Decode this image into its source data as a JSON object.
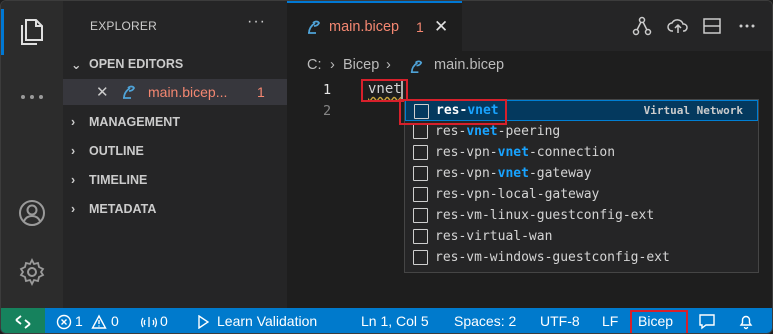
{
  "sidebar": {
    "title": "EXPLORER",
    "more": "···",
    "sections": [
      {
        "label": "OPEN EDITORS",
        "expanded": true
      },
      {
        "label": "MANAGEMENT",
        "expanded": false
      },
      {
        "label": "OUTLINE",
        "expanded": false
      },
      {
        "label": "TIMELINE",
        "expanded": false
      },
      {
        "label": "METADATA",
        "expanded": false
      }
    ],
    "open_file": {
      "close": "✕",
      "name": "main.bicep...",
      "problems": "1"
    }
  },
  "tab": {
    "name": "main.bicep",
    "problems": "1",
    "close": "✕"
  },
  "breadcrumb": {
    "drive": "C:",
    "sep1": "›",
    "folder": "Bicep",
    "sep2": "›",
    "file": "main.bicep"
  },
  "editor": {
    "line_numbers": [
      "1",
      "2"
    ],
    "line1_text": "vnet"
  },
  "suggest": {
    "selected_detail": "Virtual Network",
    "items": [
      [
        "res-",
        "vnet",
        ""
      ],
      [
        "res-",
        "vnet",
        "-peering"
      ],
      [
        "res-vpn-",
        "vnet",
        "-connection"
      ],
      [
        "res-vpn-",
        "vnet",
        "-gateway"
      ],
      [
        "res-vpn-local-gateway",
        "",
        ""
      ],
      [
        "res-vm-linux-guestconfig-ext",
        "",
        ""
      ],
      [
        "res-virtual-wan",
        "",
        ""
      ],
      [
        "res-vm-windows-guestconfig-ext",
        "",
        ""
      ]
    ]
  },
  "status": {
    "errors": "1",
    "warnings": "0",
    "ports": "0",
    "learn": "Learn Validation",
    "position": "Ln 1, Col 5",
    "spaces": "Spaces: 2",
    "encoding": "UTF-8",
    "eol": "LF",
    "language": "Bicep"
  },
  "colors": {
    "accent": "#007acc",
    "highlight": "#d8202b",
    "error_text": "#f48771",
    "match": "#18a3ff"
  },
  "icons": [
    "files-icon",
    "more-icon",
    "account-icon",
    "settings-gear-icon",
    "bicep-file-icon",
    "visualizer-icon",
    "deploy-cloud-icon",
    "split-editor-icon",
    "more-actions-icon",
    "remote-icon",
    "error-icon",
    "warning-icon",
    "ports-icon",
    "play-icon",
    "feedback-icon",
    "bell-icon"
  ]
}
